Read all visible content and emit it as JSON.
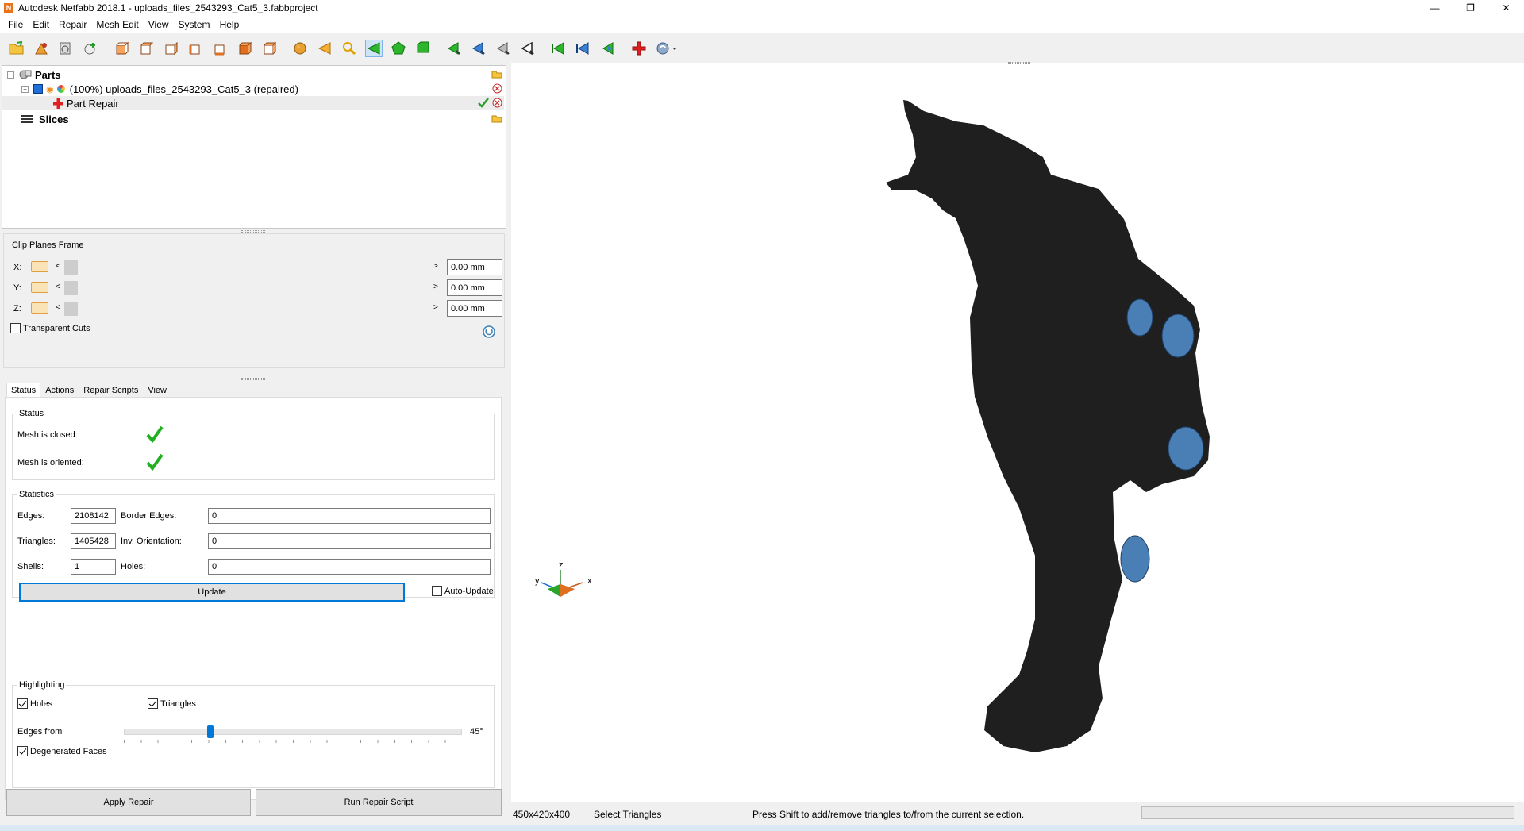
{
  "window": {
    "title": "Autodesk Netfabb 2018.1 - uploads_files_2543293_Cat5_3.fabbproject",
    "app_icon": "N"
  },
  "menu": [
    "File",
    "Edit",
    "Repair",
    "Mesh Edit",
    "View",
    "System",
    "Help"
  ],
  "toolbar": {
    "icons": [
      "open-file-icon",
      "add-part-icon",
      "import-icon",
      "add-icon",
      "view-front-icon",
      "view-back-icon",
      "view-left-icon",
      "view-right-icon",
      "view-top-icon",
      "view-bottom-icon",
      "view-iso-icon",
      "sphere-icon",
      "triangle-left-icon",
      "zoom-icon",
      "select-triangle-icon",
      "select-surface-icon",
      "select-shell-icon",
      "brush-select-icon",
      "brush-add-icon",
      "brush-remove-icon",
      "brush-invert-icon",
      "select-all-icon",
      "deselect-icon",
      "invert-select-icon",
      "add-repair-icon",
      "help-icon"
    ],
    "active": "select-triangle-icon"
  },
  "tree": {
    "parts_label": "Parts",
    "part_name": "(100%) uploads_files_2543293_Cat5_3 (repaired)",
    "repair_label": "Part Repair",
    "slices_label": "Slices"
  },
  "clip": {
    "title": "Clip Planes Frame",
    "rows": [
      {
        "axis": "X:",
        "lt": "<",
        "gt": ">",
        "value": "0.00 mm"
      },
      {
        "axis": "Y:",
        "lt": "<",
        "gt": ">",
        "value": "0.00 mm"
      },
      {
        "axis": "Z:",
        "lt": "<",
        "gt": ">",
        "value": "0.00 mm"
      }
    ],
    "transparent_cuts": "Transparent Cuts"
  },
  "tabs": [
    "Status",
    "Actions",
    "Repair Scripts",
    "View"
  ],
  "status": {
    "title": "Status",
    "mesh_closed": "Mesh is closed:",
    "mesh_oriented": "Mesh is oriented:"
  },
  "statistics": {
    "title": "Statistics",
    "edges_label": "Edges:",
    "edges": "2108142",
    "border_edges_label": "Border Edges:",
    "border_edges": "0",
    "triangles_label": "Triangles:",
    "triangles": "1405428",
    "inv_orientation_label": "Inv. Orientation:",
    "inv_orientation": "0",
    "shells_label": "Shells:",
    "shells": "1",
    "holes_label": "Holes:",
    "holes": "0",
    "update": "Update",
    "auto_update": "Auto-Update"
  },
  "highlighting": {
    "title": "Highlighting",
    "holes": "Holes",
    "triangles": "Triangles",
    "edges_from": "Edges from",
    "edges_value": "45°",
    "edges_angle_fraction": 0.25,
    "degenerated": "Degenerated Faces"
  },
  "buttons": {
    "apply_repair": "Apply Repair",
    "run_script": "Run Repair Script"
  },
  "statusbar": {
    "dimensions": "450x420x400",
    "mode": "Select Triangles",
    "hint": "Press Shift to add/remove triangles to/from the current selection."
  },
  "axes_gizmo": {
    "z": "z",
    "y": "y",
    "x": "x"
  },
  "colors": {
    "accent": "#0078d7",
    "model": "#1f1f1f",
    "selected_triangles": "#4a7fb5"
  }
}
